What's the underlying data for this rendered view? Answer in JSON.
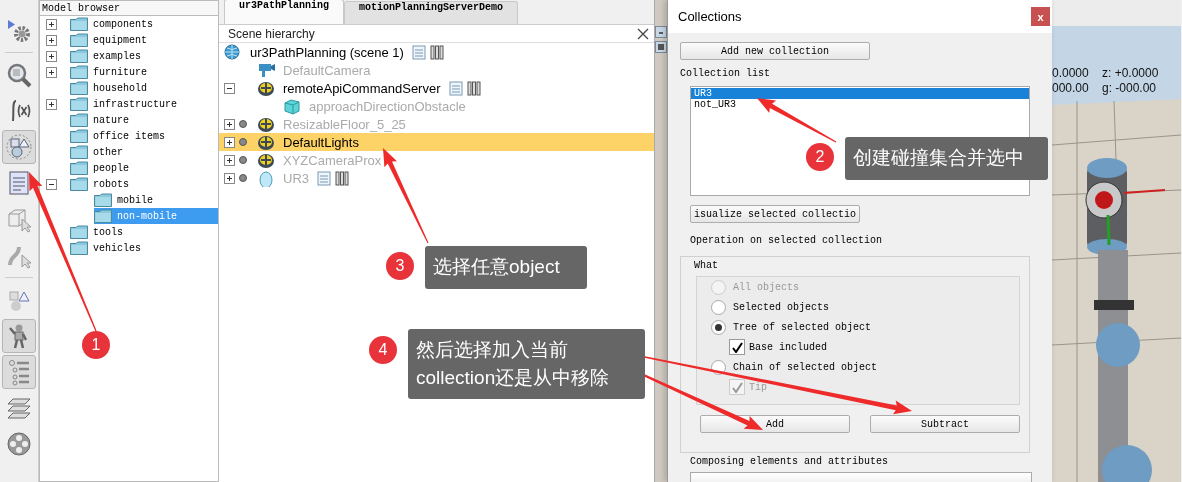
{
  "toolbar": [
    {
      "kind": "gear",
      "pressed": false
    },
    {
      "kind": "separator"
    },
    {
      "kind": "magnifier",
      "pressed": false
    },
    {
      "kind": "function",
      "pressed": false
    },
    {
      "kind": "shapes",
      "pressed": true
    },
    {
      "kind": "document",
      "pressed": false
    },
    {
      "kind": "cube-cursor",
      "pressed": false
    },
    {
      "kind": "path-cursor",
      "pressed": false
    },
    {
      "kind": "separator"
    },
    {
      "kind": "primitives",
      "pressed": false
    },
    {
      "kind": "robot",
      "pressed": true
    },
    {
      "kind": "hierarchy",
      "pressed": true
    },
    {
      "kind": "layers",
      "pressed": false
    },
    {
      "kind": "film-reel",
      "pressed": false
    }
  ],
  "model_browser": {
    "title": "Model browser",
    "items": [
      {
        "label": "components",
        "expandable": true,
        "expanded": false,
        "selected": false
      },
      {
        "label": "equipment",
        "expandable": true,
        "expanded": false,
        "selected": false
      },
      {
        "label": "examples",
        "expandable": true,
        "expanded": false,
        "selected": false
      },
      {
        "label": "furniture",
        "expandable": true,
        "expanded": false,
        "selected": false
      },
      {
        "label": "household",
        "expandable": false,
        "selected": false
      },
      {
        "label": "infrastructure",
        "expandable": true,
        "expanded": false,
        "selected": false
      },
      {
        "label": "nature",
        "expandable": false,
        "selected": false
      },
      {
        "label": "office items",
        "expandable": false,
        "selected": false
      },
      {
        "label": "other",
        "expandable": false,
        "selected": false
      },
      {
        "label": "people",
        "expandable": false,
        "selected": false
      },
      {
        "label": "robots",
        "expandable": true,
        "expanded": true,
        "selected": false,
        "children": [
          {
            "label": "mobile",
            "expandable": false,
            "selected": false
          },
          {
            "label": "non-mobile",
            "expandable": false,
            "selected": true
          }
        ]
      },
      {
        "label": "tools",
        "expandable": false,
        "selected": false
      },
      {
        "label": "vehicles",
        "expandable": false,
        "selected": false
      }
    ]
  },
  "scene": {
    "tabs": [
      {
        "label": "ur3PathPlanning",
        "selected": true
      },
      {
        "label": "motionPlanningServerDemo",
        "selected": false
      }
    ],
    "title": "Scene hierarchy",
    "items": [
      {
        "label": "ur3PathPlanning (scene 1)",
        "kind": "scene",
        "dimmed": false,
        "selected": false,
        "expandable": false,
        "script": true,
        "bars": true,
        "children": [
          {
            "label": "DefaultCamera",
            "kind": "camera",
            "dimmed": true,
            "selected": false,
            "expandable": false,
            "script": false,
            "bars": false
          },
          {
            "label": "remoteApiCommandServer",
            "kind": "dummy",
            "dimmed": false,
            "selected": false,
            "expandable": true,
            "expanded": true,
            "script": true,
            "bars": true,
            "children": [
              {
                "label": "approachDirectionObstacle",
                "kind": "cube",
                "dimmed": true,
                "selected": false,
                "expandable": false,
                "script": false,
                "bars": false
              }
            ]
          },
          {
            "label": "ResizableFloor_5_25",
            "kind": "dummy",
            "dimmed": true,
            "selected": false,
            "expandable": true,
            "expanded": false,
            "script": false,
            "bars": false
          },
          {
            "label": "DefaultLights",
            "kind": "dummy",
            "dimmed": false,
            "selected": true,
            "expandable": true,
            "expanded": false,
            "script": false,
            "bars": false
          },
          {
            "label": "XYZCameraProx",
            "kind": "dummy",
            "dimmed": true,
            "selected": false,
            "expandable": true,
            "expanded": false,
            "script": false,
            "bars": false
          },
          {
            "label": "UR3",
            "kind": "shape",
            "dimmed": true,
            "selected": false,
            "expandable": true,
            "expanded": false,
            "script": true,
            "bars": true
          }
        ]
      }
    ]
  },
  "collections": {
    "title": "Collections",
    "close": "x",
    "add_button": "Add new collection",
    "list_label": "Collection list",
    "list": [
      {
        "label": "UR3",
        "selected": true
      },
      {
        "label": "not_UR3",
        "selected": false
      }
    ],
    "visualize_button": "isualize selected collectio",
    "operation_label": "Operation on selected collection",
    "group_title": "What",
    "options": [
      {
        "kind": "radio",
        "label": "All objects",
        "selected": false,
        "disabled": true
      },
      {
        "kind": "radio",
        "label": "Selected objects",
        "selected": false,
        "disabled": false
      },
      {
        "kind": "radio",
        "label": "Tree of selected object",
        "selected": true,
        "disabled": false
      },
      {
        "kind": "checkbox",
        "label": "Base included",
        "checked": true,
        "disabled": false
      },
      {
        "kind": "radio",
        "label": "Chain of selected object",
        "selected": false,
        "disabled": false
      },
      {
        "kind": "checkbox",
        "label": "Tip",
        "checked": true,
        "disabled": true
      }
    ],
    "buttons": [
      "Add",
      "Subtract"
    ],
    "composing_label": "Composing elements and attributes"
  },
  "viewport": {
    "readouts": [
      "0.0000",
      "z: +0.0000",
      "000.00",
      "g: -000.00"
    ]
  },
  "annotations": [
    {
      "number": "1"
    },
    {
      "number": "2",
      "text": "创建碰撞集合并选中"
    },
    {
      "number": "3",
      "text": "选择任意object"
    },
    {
      "number": "4",
      "text": "然后选择加入当前collection还是从中移除"
    }
  ]
}
